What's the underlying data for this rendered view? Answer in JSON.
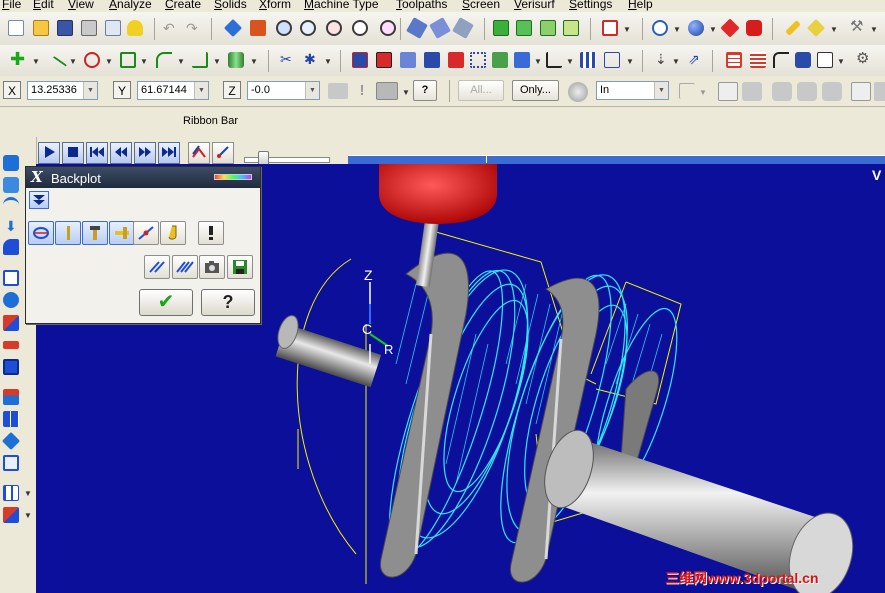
{
  "menu": {
    "items": [
      "File",
      "Edit",
      "View",
      "Analyze",
      "Create",
      "Solids",
      "Xform",
      "Machine Type",
      "Toolpaths",
      "Screen",
      "Verisurf",
      "Settings",
      "Help"
    ]
  },
  "toolbars": {
    "row1_icons": [
      "new-file-icon",
      "open-folder-icon",
      "save-icon",
      "print-icon",
      "print-preview-icon",
      "wizard-icon",
      "undo-icon",
      "redo-icon",
      "pan-icon",
      "fit-icon",
      "zoom-window-icon",
      "zoom-out-icon",
      "zoom-icon",
      "repaint-icon",
      "shade-icon",
      "wireframe-icon",
      "solid-box-icon",
      "solid-cube-icon",
      "solid-cube-2-icon",
      "solid-cube-3-icon",
      "solid-red-icon",
      "globe-icon",
      "sphere-icon",
      "red-cube-icon",
      "red-shape-icon",
      "pencil-icon",
      "highlighter-icon",
      "wrench-icon"
    ],
    "row2_icons": [
      "point-icon",
      "line-icon",
      "arc-icon",
      "rectangle-icon",
      "fillet-icon",
      "chain-icon",
      "solid-extrude-icon",
      "trim-icon",
      "break-icon",
      "xform-icon",
      "translate-icon",
      "rotate-icon",
      "mirror-icon",
      "group-icon",
      "offset-icon",
      "arrow-icon",
      "array-icon",
      "hatch-icon",
      "table-icon",
      "dimension-icon",
      "drill-icon",
      "pocket-icon",
      "settings-icon"
    ]
  },
  "coordinates": {
    "x_label": "X",
    "x_value": "13.25336",
    "y_label": "Y",
    "y_value": "61.67144",
    "z_label": "Z",
    "z_value": "-0.0",
    "all_label": "All...",
    "only_label": "Only...",
    "units_value": "In"
  },
  "ribbon": {
    "label": "Ribbon Bar"
  },
  "playback": {
    "buttons": [
      "play",
      "stop",
      "step-back",
      "back",
      "forward",
      "step-forward"
    ]
  },
  "viewport": {
    "axis_z": "Z",
    "axis_c": "C",
    "axis_r": "R",
    "top_right_label": "V"
  },
  "backplot": {
    "title": "Backplot",
    "ok_label": "✔",
    "help_label": "?"
  },
  "watermark": "三维网www.3dportal.cn",
  "colors": {
    "viewport_bg": "#0b0f9a",
    "toolpath": "#2fe8ff",
    "tool_holder": "#e81414",
    "boundary": "#f2f200",
    "part": "#9a9a9a"
  }
}
